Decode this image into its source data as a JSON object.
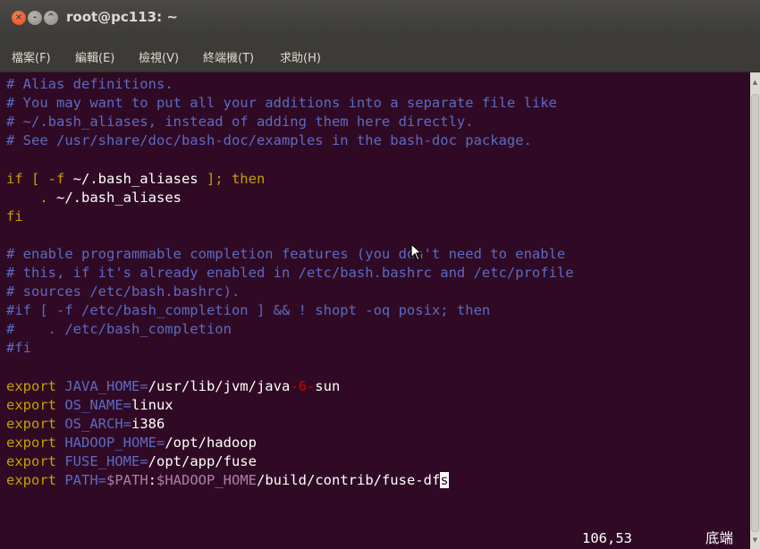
{
  "window": {
    "title": "root@pc113: ~"
  },
  "window_buttons": {
    "close": "×",
    "minimize": "-",
    "maximize": "^"
  },
  "menu": [
    "檔案(F)",
    "編輯(E)",
    "檢視(V)",
    "終端機(T)",
    "求助(H)"
  ],
  "lines": [
    [
      {
        "t": "# Alias definitions.",
        "c": "c"
      }
    ],
    [
      {
        "t": "# You may want to put all your additions into a separate file like",
        "c": "c"
      }
    ],
    [
      {
        "t": "# ~/.bash_aliases, instead of adding them here directly.",
        "c": "c"
      }
    ],
    [
      {
        "t": "# See /usr/share/doc/bash-doc/examples in the bash-doc package.",
        "c": "c"
      }
    ],
    [],
    [
      {
        "t": "if [ -f ",
        "c": "y"
      },
      {
        "t": "~/.bash_aliases",
        "c": "w"
      },
      {
        "t": " ]; then",
        "c": "y"
      }
    ],
    [
      {
        "t": "    . ",
        "c": "y"
      },
      {
        "t": "~/.bash_aliases",
        "c": "w"
      }
    ],
    [
      {
        "t": "fi",
        "c": "y"
      }
    ],
    [],
    [
      {
        "t": "# enable programmable completion features (you don't need to enable",
        "c": "c"
      }
    ],
    [
      {
        "t": "# this, if it's already enabled in /etc/bash.bashrc and /etc/profile",
        "c": "c"
      }
    ],
    [
      {
        "t": "# sources /etc/bash.bashrc).",
        "c": "c"
      }
    ],
    [
      {
        "t": "#if [ -f /etc/bash_completion ] && ! shopt -oq posix; then",
        "c": "c"
      }
    ],
    [
      {
        "t": "#    . /etc/bash_completion",
        "c": "c"
      }
    ],
    [
      {
        "t": "#fi",
        "c": "c"
      }
    ],
    [],
    [
      {
        "t": "export ",
        "c": "y"
      },
      {
        "t": "JAVA_HOME=",
        "c": "c"
      },
      {
        "t": "/usr/lib/jvm/java",
        "c": "w"
      },
      {
        "t": "-6-",
        "c": "r"
      },
      {
        "t": "sun",
        "c": "w"
      }
    ],
    [
      {
        "t": "export ",
        "c": "y"
      },
      {
        "t": "OS_NAME=",
        "c": "c"
      },
      {
        "t": "linux",
        "c": "w"
      }
    ],
    [
      {
        "t": "export ",
        "c": "y"
      },
      {
        "t": "OS_ARCH=",
        "c": "c"
      },
      {
        "t": "i386",
        "c": "w"
      }
    ],
    [
      {
        "t": "export ",
        "c": "y"
      },
      {
        "t": "HADOOP_HOME=",
        "c": "c"
      },
      {
        "t": "/opt/hadoop",
        "c": "w"
      }
    ],
    [
      {
        "t": "export ",
        "c": "y"
      },
      {
        "t": "FUSE_HOME=",
        "c": "c"
      },
      {
        "t": "/opt/app/fuse",
        "c": "w"
      }
    ],
    [
      {
        "t": "export ",
        "c": "y"
      },
      {
        "t": "PATH=",
        "c": "c"
      },
      {
        "t": "$PATH",
        "c": "p"
      },
      {
        "t": ":",
        "c": "w"
      },
      {
        "t": "$HADOOP_HOME",
        "c": "p"
      },
      {
        "t": "/build/contrib/fuse-df",
        "c": "w"
      },
      {
        "t": "s",
        "c": "cursor"
      }
    ]
  ],
  "status": {
    "position": "106,53",
    "location": "底端"
  },
  "colors": {
    "terminal_bg": "#300a24",
    "comment": "#5c6ac4",
    "keyword": "#c4a000",
    "text": "#ffffff",
    "number": "#cc0000",
    "variable": "#ad7fa8"
  }
}
